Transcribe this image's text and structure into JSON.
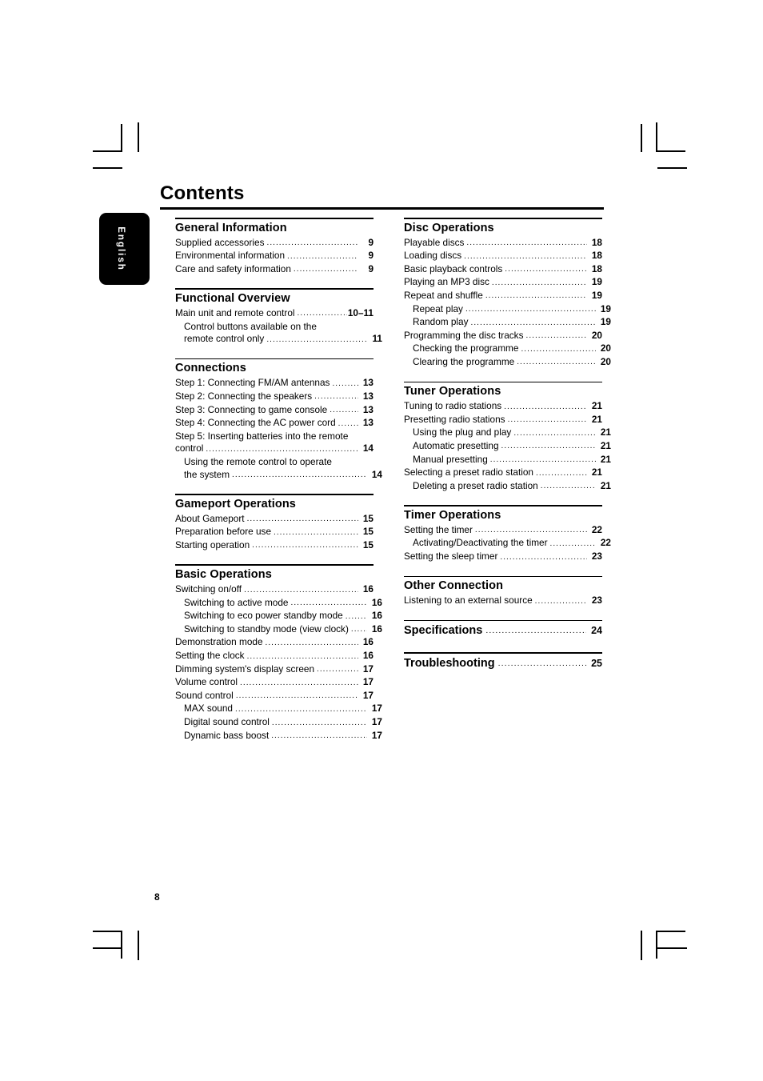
{
  "page": {
    "title": "Contents",
    "page_number": "8",
    "language_tab": "English"
  },
  "columns": {
    "left": [
      {
        "heading": "General Information",
        "entries": [
          {
            "label": "Supplied accessories",
            "page": "9",
            "level": 0
          },
          {
            "label": "Environmental information",
            "page": "9",
            "level": 0
          },
          {
            "label": "Care and safety information",
            "page": "9",
            "level": 0
          }
        ]
      },
      {
        "heading": "Functional Overview",
        "entries": [
          {
            "label": "Main unit and remote control",
            "page": "10–11",
            "level": 0
          },
          {
            "label": "Control buttons available on the",
            "page": "",
            "level": 1,
            "wrap": "first"
          },
          {
            "label": "remote control only",
            "page": "11",
            "level": 1,
            "wrap": "last"
          }
        ]
      },
      {
        "heading": "Connections",
        "entries": [
          {
            "label": "Step 1: Connecting FM/AM antennas",
            "page": "13",
            "level": 0
          },
          {
            "label": "Step 2: Connecting the speakers",
            "page": "13",
            "level": 0
          },
          {
            "label": "Step 3: Connecting to game console",
            "page": "13",
            "level": 0
          },
          {
            "label": "Step 4: Connecting the AC power cord",
            "page": "13",
            "level": 0
          },
          {
            "label": "Step 5: Inserting batteries into the remote",
            "page": "",
            "level": 0,
            "wrap": "first"
          },
          {
            "label": "control",
            "page": "14",
            "level": 0,
            "wrap": "last"
          },
          {
            "label": "Using the remote control to operate",
            "page": "",
            "level": 1,
            "wrap": "first"
          },
          {
            "label": "the system",
            "page": "14",
            "level": 1,
            "wrap": "last"
          }
        ]
      },
      {
        "heading": "Gameport Operations",
        "entries": [
          {
            "label": "About Gameport",
            "page": "15",
            "level": 0
          },
          {
            "label": "Preparation before use",
            "page": "15",
            "level": 0
          },
          {
            "label": "Starting operation",
            "page": "15",
            "level": 0
          }
        ]
      },
      {
        "heading": "Basic Operations",
        "entries": [
          {
            "label": "Switching on/off",
            "page": "16",
            "level": 0
          },
          {
            "label": "Switching to active mode",
            "page": "16",
            "level": 1
          },
          {
            "label": "Switching to eco power standby mode",
            "page": "16",
            "level": 1
          },
          {
            "label": "Switching to standby mode (view clock)",
            "page": "16",
            "level": 1
          },
          {
            "label": "Demonstration mode",
            "page": "16",
            "level": 0
          },
          {
            "label": "Setting the clock",
            "page": "16",
            "level": 0
          },
          {
            "label": "Dimming system's display screen",
            "page": "17",
            "level": 0
          },
          {
            "label": "Volume control",
            "page": "17",
            "level": 0
          },
          {
            "label": "Sound control",
            "page": "17",
            "level": 0
          },
          {
            "label": "MAX sound",
            "page": "17",
            "level": 1
          },
          {
            "label": "Digital sound control",
            "page": "17",
            "level": 1
          },
          {
            "label": "Dynamic bass boost",
            "page": "17",
            "level": 1
          }
        ]
      }
    ],
    "right": [
      {
        "heading": "Disc Operations",
        "entries": [
          {
            "label": "Playable discs",
            "page": "18",
            "level": 0
          },
          {
            "label": "Loading discs",
            "page": "18",
            "level": 0
          },
          {
            "label": "Basic playback controls",
            "page": "18",
            "level": 0
          },
          {
            "label": "Playing an MP3 disc",
            "page": "19",
            "level": 0
          },
          {
            "label": "Repeat and shuffle",
            "page": "19",
            "level": 0
          },
          {
            "label": "Repeat play",
            "page": "19",
            "level": 1
          },
          {
            "label": "Random play",
            "page": "19",
            "level": 1
          },
          {
            "label": "Programming the disc tracks",
            "page": "20",
            "level": 0
          },
          {
            "label": "Checking the programme",
            "page": "20",
            "level": 1
          },
          {
            "label": "Clearing the programme",
            "page": "20",
            "level": 1
          }
        ]
      },
      {
        "heading": "Tuner Operations",
        "entries": [
          {
            "label": "Tuning to radio stations",
            "page": "21",
            "level": 0
          },
          {
            "label": "Presetting radio stations",
            "page": "21",
            "level": 0
          },
          {
            "label": "Using the plug and play",
            "page": "21",
            "level": 1
          },
          {
            "label": "Automatic presetting",
            "page": "21",
            "level": 1
          },
          {
            "label": "Manual presetting",
            "page": "21",
            "level": 1
          },
          {
            "label": "Selecting a preset radio station",
            "page": "21",
            "level": 0
          },
          {
            "label": "Deleting a preset radio station",
            "page": "21",
            "level": 1
          }
        ]
      },
      {
        "heading": "Timer Operations",
        "entries": [
          {
            "label": "Setting the timer",
            "page": "22",
            "level": 0
          },
          {
            "label": "Activating/Deactivating the timer",
            "page": "22",
            "level": 1
          },
          {
            "label": "Setting the sleep timer",
            "page": "23",
            "level": 0
          }
        ]
      },
      {
        "heading": "Other Connection",
        "entries": [
          {
            "label": "Listening to an external source",
            "page": "23",
            "level": 0
          }
        ]
      },
      {
        "heading": "Specifications",
        "heading_page": "24",
        "entries": []
      },
      {
        "heading": "Troubleshooting",
        "heading_page": "25",
        "entries": []
      }
    ]
  }
}
